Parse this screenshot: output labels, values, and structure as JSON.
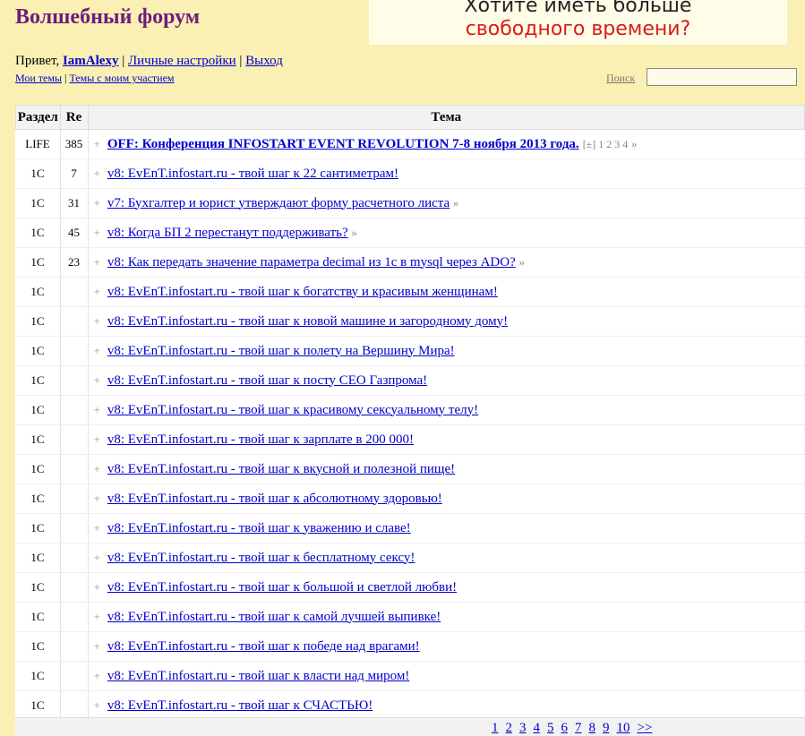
{
  "site": {
    "title": "Волшебный форум"
  },
  "banner": {
    "line1": "Хотите иметь больше",
    "line2": "свободного времени?"
  },
  "user": {
    "greeting": "Привет, ",
    "name": "IamAlexy",
    "sep": " | ",
    "settings": "Личные настройки",
    "logout": "Выход",
    "my_topics": "Мои темы",
    "my_participation": "Темы с моим участием"
  },
  "search": {
    "label": "Поиск",
    "value": ""
  },
  "table": {
    "headers": {
      "section": "Раздел",
      "replies": "Re",
      "topic": "Тема"
    },
    "rows": [
      {
        "section": "LIFE",
        "replies": "385",
        "title": "OFF: Конференция INFOSTART EVENT REVOLUTION 7-8 ноября 2013 года.",
        "bold": true,
        "extra": "[±] 1 2 3 4",
        "more": "»"
      },
      {
        "section": "1C",
        "replies": "7",
        "title": "v8: EvEnT.infostart.ru - твой шаг к 22 сантиметрам!",
        "more": ""
      },
      {
        "section": "1C",
        "replies": "31",
        "title": "v7: Бухгалтер и юрист утверждают форму расчетного листа",
        "more": "»"
      },
      {
        "section": "1C",
        "replies": "45",
        "title": "v8: Когда БП 2 перестанут поддерживать?",
        "more": "»"
      },
      {
        "section": "1C",
        "replies": "23",
        "title": "v8: Как передать значение параметра decimal из 1с в mysql через ADO?",
        "more": "»"
      },
      {
        "section": "1C",
        "replies": "",
        "title": "v8: EvEnT.infostart.ru - твой шаг к богатству и красивым женщинам!",
        "more": ""
      },
      {
        "section": "1C",
        "replies": "",
        "title": "v8: EvEnT.infostart.ru - твой шаг к новой машине и загородному дому!",
        "more": ""
      },
      {
        "section": "1C",
        "replies": "",
        "title": "v8: EvEnT.infostart.ru - твой шаг к полету на Вершину Мира!",
        "more": ""
      },
      {
        "section": "1C",
        "replies": "",
        "title": "v8: EvEnT.infostart.ru - твой шаг к посту CEO Газпрома!",
        "more": ""
      },
      {
        "section": "1C",
        "replies": "",
        "title": "v8: EvEnT.infostart.ru - твой шаг к красивому сексуальному телу!",
        "more": ""
      },
      {
        "section": "1C",
        "replies": "",
        "title": "v8: EvEnT.infostart.ru - твой шаг к зарплате в 200 000!",
        "more": ""
      },
      {
        "section": "1C",
        "replies": "",
        "title": "v8: EvEnT.infostart.ru - твой шаг к вкусной и полезной пище!",
        "more": ""
      },
      {
        "section": "1C",
        "replies": "",
        "title": "v8: EvEnT.infostart.ru - твой шаг к абсолютному здоровью!",
        "more": ""
      },
      {
        "section": "1C",
        "replies": "",
        "title": "v8: EvEnT.infostart.ru - твой шаг к уважению и славе!",
        "more": ""
      },
      {
        "section": "1C",
        "replies": "",
        "title": "v8: EvEnT.infostart.ru - твой шаг к бесплатному сексу!",
        "more": ""
      },
      {
        "section": "1C",
        "replies": "",
        "title": "v8: EvEnT.infostart.ru - твой шаг к большой и светлой любви!",
        "more": ""
      },
      {
        "section": "1C",
        "replies": "",
        "title": "v8: EvEnT.infostart.ru - твой шаг к самой лучшей выпивке!",
        "more": ""
      },
      {
        "section": "1C",
        "replies": "",
        "title": "v8: EvEnT.infostart.ru - твой шаг к победе над врагами!",
        "more": ""
      },
      {
        "section": "1C",
        "replies": "",
        "title": "v8: EvEnT.infostart.ru - твой шаг к власти над миром!",
        "more": ""
      },
      {
        "section": "1C",
        "replies": "",
        "title": "v8: EvEnT.infostart.ru - твой шаг к СЧАСТЬЮ!",
        "more": ""
      }
    ],
    "plus": "+"
  },
  "pager": {
    "pages": [
      "1",
      "2",
      "3",
      "4",
      "5",
      "6",
      "7",
      "8",
      "9",
      "10"
    ],
    "next": ">>"
  }
}
